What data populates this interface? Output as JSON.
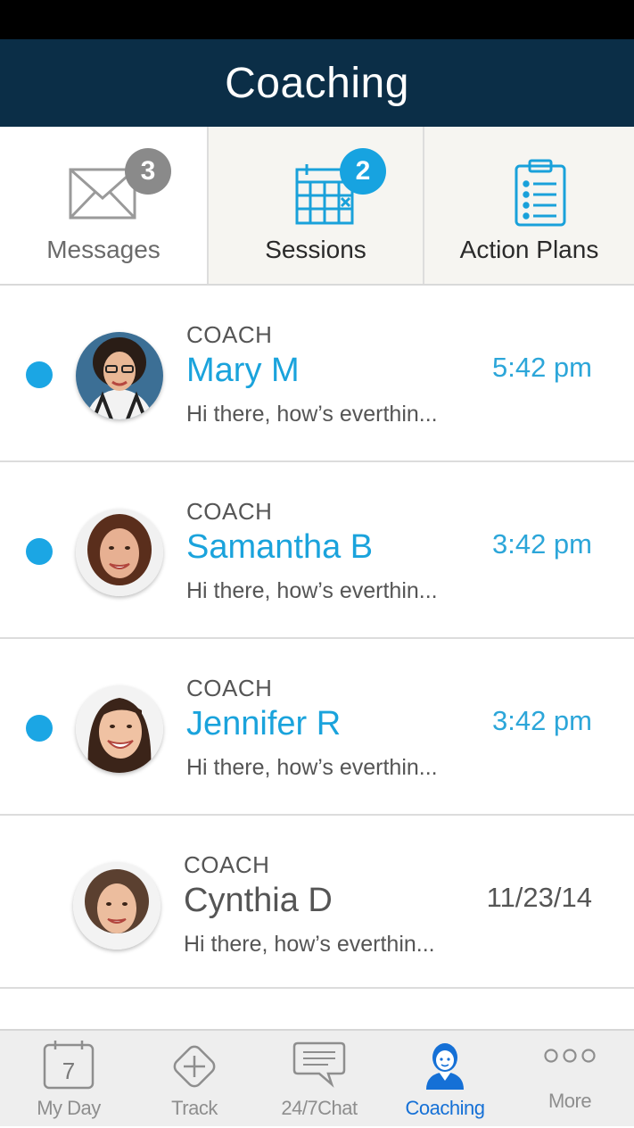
{
  "header": {
    "title": "Coaching"
  },
  "segments": [
    {
      "label": "Messages",
      "icon": "envelope-icon",
      "badge": "3"
    },
    {
      "label": "Sessions",
      "icon": "calendar-icon",
      "badge": "2"
    },
    {
      "label": "Action Plans",
      "icon": "clipboard-icon"
    }
  ],
  "messages": [
    {
      "role": "COACH",
      "name": "Mary M",
      "preview": "Hi there, how’s everthin...",
      "time": "5:42 pm",
      "unread": true
    },
    {
      "role": "COACH",
      "name": "Samantha B",
      "preview": "Hi there, how’s everthin...",
      "time": "3:42 pm",
      "unread": true
    },
    {
      "role": "COACH",
      "name": "Jennifer R",
      "preview": "Hi there, how’s everthin...",
      "time": "3:42 pm",
      "unread": true
    },
    {
      "role": "COACH",
      "name": "Cynthia D",
      "preview": "Hi there, how’s everthin...",
      "time": "11/23/14",
      "unread": false
    }
  ],
  "tabbar": {
    "items": [
      {
        "label": "My Day",
        "icon": "calendar-day-icon",
        "day": "7"
      },
      {
        "label": "Track",
        "icon": "plus-diamond-icon"
      },
      {
        "label": "24/7Chat",
        "icon": "chat-bubble-icon"
      },
      {
        "label": "Coaching",
        "icon": "coach-person-icon",
        "active": true
      },
      {
        "label": "More",
        "icon": "more-dots-icon"
      }
    ]
  },
  "colors": {
    "header_bg": "#0b2e47",
    "accent_blue": "#1aa3dc",
    "tab_active": "#1570d6",
    "badge_gray": "#8a8a8a",
    "badge_blue": "#17a3e0"
  }
}
